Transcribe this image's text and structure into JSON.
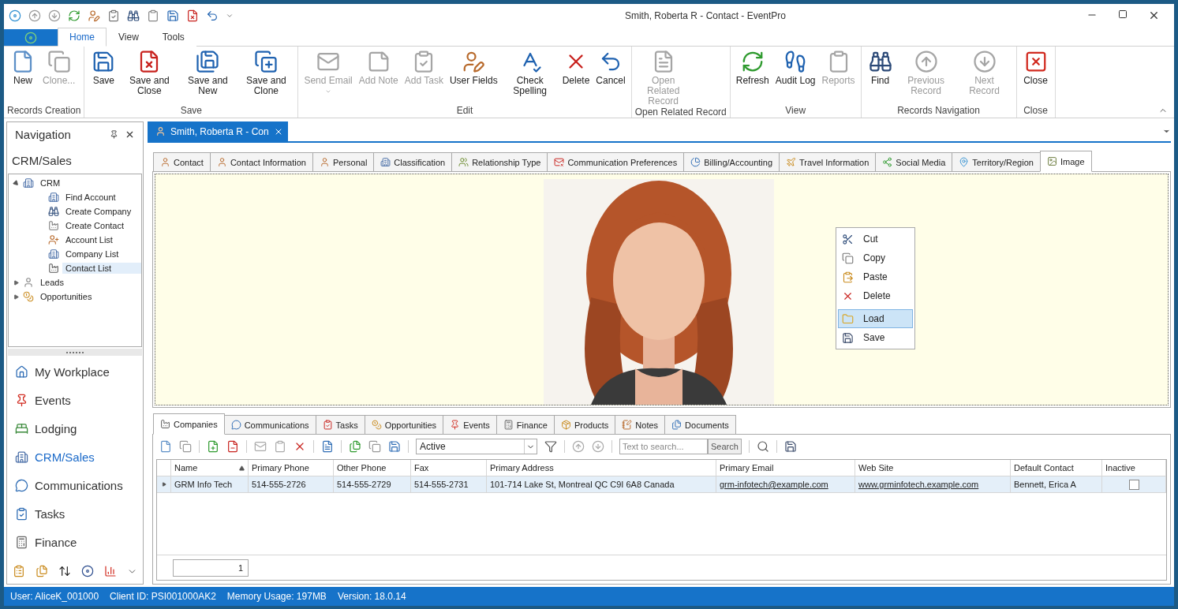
{
  "window": {
    "title": "Smith, Roberta R - Contact - EventPro"
  },
  "ribbon_tabs": [
    {
      "label": "Home",
      "selected": true
    },
    {
      "label": "View",
      "selected": false
    },
    {
      "label": "Tools",
      "selected": false
    }
  ],
  "ribbon_groups": [
    {
      "title": "Records Creation",
      "buttons": [
        {
          "label": "New",
          "disabled": false
        },
        {
          "label": "Clone...",
          "disabled": true
        }
      ]
    },
    {
      "title": "Save",
      "buttons": [
        {
          "label": "Save",
          "disabled": false
        },
        {
          "label": "Save and Close",
          "disabled": false
        },
        {
          "label": "Save and New",
          "disabled": false
        },
        {
          "label": "Save and Clone",
          "disabled": false
        }
      ]
    },
    {
      "title": "Edit",
      "buttons": [
        {
          "label": "Send Email",
          "disabled": true,
          "dropdown": true
        },
        {
          "label": "Add Note",
          "disabled": true
        },
        {
          "label": "Add Task",
          "disabled": true
        },
        {
          "label": "User Fields",
          "disabled": false
        },
        {
          "label": "Check Spelling",
          "disabled": false
        },
        {
          "label": "Delete",
          "disabled": false
        },
        {
          "label": "Cancel",
          "disabled": false
        }
      ]
    },
    {
      "title": "Open Related Record",
      "buttons": [
        {
          "label": "Open Related Record",
          "disabled": true
        }
      ]
    },
    {
      "title": "View",
      "buttons": [
        {
          "label": "Refresh",
          "disabled": false
        },
        {
          "label": "Audit Log",
          "disabled": false
        },
        {
          "label": "Reports",
          "disabled": true
        }
      ]
    },
    {
      "title": "Records Navigation",
      "buttons": [
        {
          "label": "Find",
          "disabled": false
        },
        {
          "label": "Previous Record",
          "disabled": true
        },
        {
          "label": "Next Record",
          "disabled": true
        }
      ]
    },
    {
      "title": "Close",
      "buttons": [
        {
          "label": "Close",
          "disabled": false
        }
      ]
    }
  ],
  "navigation": {
    "title": "Navigation",
    "section": "CRM/Sales",
    "tree": [
      {
        "label": "CRM",
        "expanded": true,
        "selected": false,
        "children": [
          {
            "label": "Find Account",
            "selected": false
          },
          {
            "label": "Create Company",
            "selected": false
          },
          {
            "label": "Create Contact",
            "selected": false
          },
          {
            "label": "Account List",
            "selected": false
          },
          {
            "label": "Company List",
            "selected": false
          },
          {
            "label": "Contact List",
            "selected": true
          }
        ]
      },
      {
        "label": "Leads",
        "expanded": false,
        "selected": false
      },
      {
        "label": "Opportunities",
        "expanded": false,
        "selected": false
      }
    ],
    "modules": [
      {
        "label": "My Workplace",
        "selected": false
      },
      {
        "label": "Events",
        "selected": false
      },
      {
        "label": "Lodging",
        "selected": false
      },
      {
        "label": "CRM/Sales",
        "selected": true
      },
      {
        "label": "Communications",
        "selected": false
      },
      {
        "label": "Tasks",
        "selected": false
      },
      {
        "label": "Finance",
        "selected": false
      }
    ]
  },
  "document_tab": {
    "label": "Smith, Roberta R - Con"
  },
  "detail_tabs": [
    {
      "label": "Contact",
      "selected": false
    },
    {
      "label": "Contact Information",
      "selected": false
    },
    {
      "label": "Personal",
      "selected": false
    },
    {
      "label": "Classification",
      "selected": false
    },
    {
      "label": "Relationship Type",
      "selected": false
    },
    {
      "label": "Communication Preferences",
      "selected": false
    },
    {
      "label": "Billing/Accounting",
      "selected": false
    },
    {
      "label": "Travel Information",
      "selected": false
    },
    {
      "label": "Social Media",
      "selected": false
    },
    {
      "label": "Territory/Region",
      "selected": false
    },
    {
      "label": "Image",
      "selected": true
    }
  ],
  "context_menu": [
    {
      "label": "Cut",
      "selected": false
    },
    {
      "label": "Copy",
      "selected": false
    },
    {
      "label": "Paste",
      "selected": false
    },
    {
      "label": "Delete",
      "selected": false
    },
    {
      "label": "Load",
      "selected": true,
      "separator_before": true
    },
    {
      "label": "Save",
      "selected": false
    }
  ],
  "bottom_tabs": [
    {
      "label": "Companies",
      "selected": true
    },
    {
      "label": "Communications",
      "selected": false
    },
    {
      "label": "Tasks",
      "selected": false
    },
    {
      "label": "Opportunities",
      "selected": false
    },
    {
      "label": "Events",
      "selected": false
    },
    {
      "label": "Finance",
      "selected": false
    },
    {
      "label": "Products",
      "selected": false
    },
    {
      "label": "Notes",
      "selected": false
    },
    {
      "label": "Documents",
      "selected": false
    }
  ],
  "grid_toolbar": {
    "filter": "Active",
    "search_placeholder": "Text to search...",
    "search_button": "Search"
  },
  "table": {
    "columns": [
      {
        "label": "Name",
        "kind": "text",
        "sorted": true
      },
      {
        "label": "Primary Phone",
        "kind": "text"
      },
      {
        "label": "Other Phone",
        "kind": "text"
      },
      {
        "label": "Fax",
        "kind": "text"
      },
      {
        "label": "Primary Address",
        "kind": "text"
      },
      {
        "label": "Primary Email",
        "kind": "link"
      },
      {
        "label": "Web Site",
        "kind": "link"
      },
      {
        "label": "Default Contact",
        "kind": "text"
      },
      {
        "label": "Inactive",
        "kind": "checkbox"
      }
    ],
    "rows": [
      {
        "selected": true,
        "inactive": false,
        "cells": [
          "GRM Info Tech",
          "514-555-2726",
          "514-555-2729",
          "514-555-2731",
          "101-714 Lake St, Montreal QC C9I 6A8 Canada",
          "grm-infotech@example.com",
          "www.grminfotech.example.com",
          "Bennett, Erica A"
        ]
      }
    ]
  },
  "footer": {
    "count": "1"
  },
  "status_bar": [
    "User: AliceK_001000",
    "Client ID: PSI001000AK2",
    "Memory Usage: 197MB",
    "Version: 18.0.14"
  ]
}
